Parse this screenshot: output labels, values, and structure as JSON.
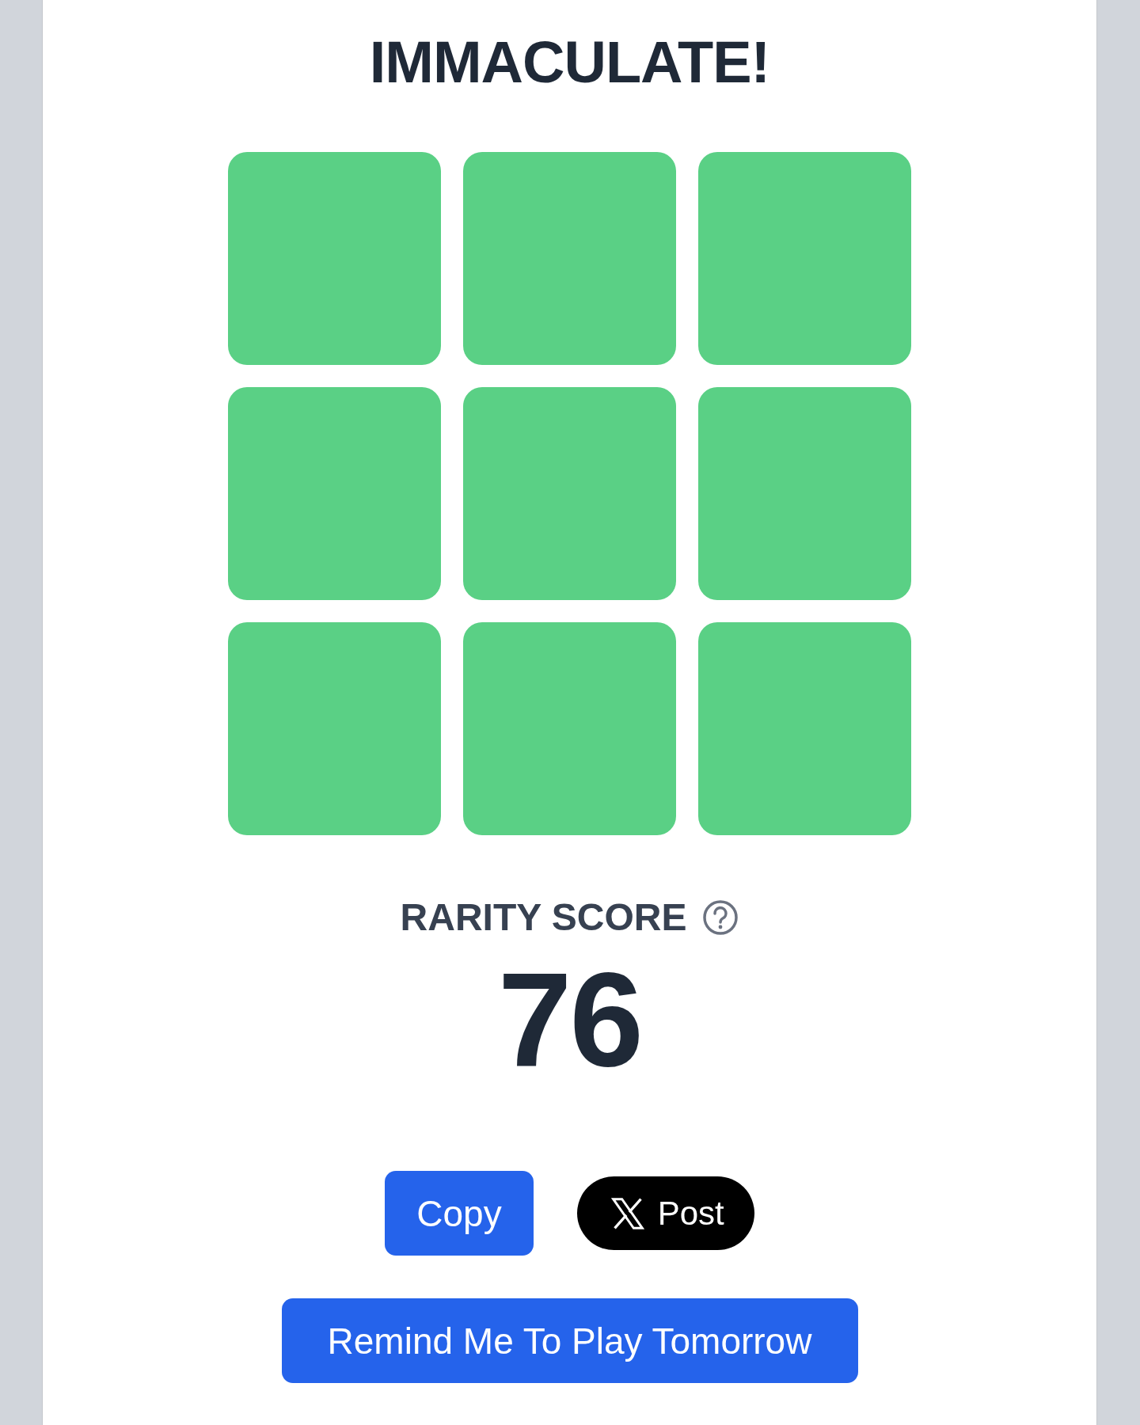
{
  "title": "IMMACULATE!",
  "grid": [
    {
      "correct": true
    },
    {
      "correct": true
    },
    {
      "correct": true
    },
    {
      "correct": true
    },
    {
      "correct": true
    },
    {
      "correct": true
    },
    {
      "correct": true
    },
    {
      "correct": true
    },
    {
      "correct": true
    }
  ],
  "rarity": {
    "label": "RARITY SCORE",
    "score": "76"
  },
  "share_buttons": [
    {
      "kind": "copy",
      "label": "Copy"
    },
    {
      "kind": "post",
      "label": "Post"
    }
  ],
  "remind_button": "Remind Me To Play Tomorrow"
}
